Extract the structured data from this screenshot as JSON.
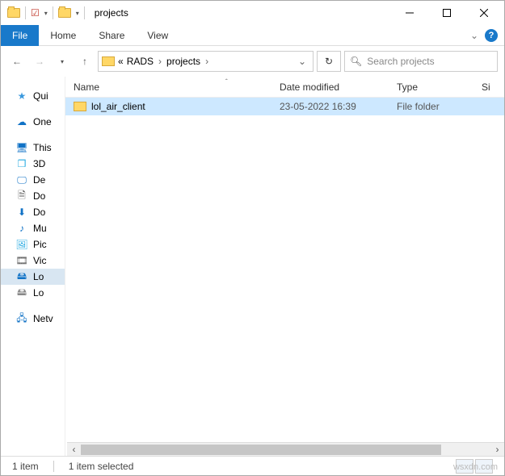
{
  "title": "projects",
  "ribbon": {
    "file": "File",
    "home": "Home",
    "share": "Share",
    "view": "View"
  },
  "breadcrumb": {
    "prefix": "«",
    "parts": [
      "RADS",
      "projects"
    ]
  },
  "search": {
    "placeholder": "Search projects"
  },
  "columns": {
    "name": "Name",
    "date": "Date modified",
    "type": "Type",
    "size": "Si"
  },
  "rows": [
    {
      "name": "lol_air_client",
      "date": "23-05-2022 16:39",
      "type": "File folder"
    }
  ],
  "sidebar": {
    "quick": "Qui",
    "onedrive": "One",
    "thispc": "This",
    "objects3d": "3D",
    "desktop": "De",
    "documents": "Do",
    "downloads": "Do",
    "music": "Mu",
    "pictures": "Pic",
    "videos": "Vic",
    "localdisk": "Lo",
    "localdisk2": "Lo",
    "network": "Netv"
  },
  "status": {
    "count": "1 item",
    "selection": "1 item selected"
  },
  "watermark": "wsxdn.com"
}
